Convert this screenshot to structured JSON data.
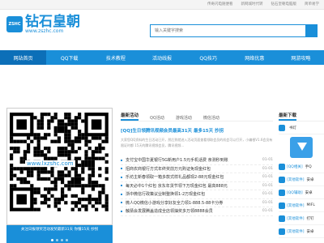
{
  "top_links": [
    "传奇闪电随便看",
    "新网城时代转",
    "钻石皇朝电脑版",
    "简单易学"
  ],
  "logo": {
    "badge": "ZSHC",
    "name": "钻石皇朝",
    "url": "www.zszhc.com"
  },
  "search": {
    "placeholder": "输入关键字搜索"
  },
  "nav": [
    "网站首页",
    "QQ下载",
    "技术教程",
    "活动线报",
    "QQ技巧",
    "网络优惠",
    "网游攻略"
  ],
  "qr": {
    "url_text": "www.lxzshc.com",
    "caption": "关注日报领奖活动发奖最新31天 你懂15天 抄拐"
  },
  "news": {
    "tabs": [
      "最新活动",
      "QQ活动",
      "游戏活动",
      "微信活动"
    ],
    "headline": "[QQ]生日领腾讯视频会员最高31天 最多15天 抄拐",
    "summary": "大家您QQ资料的生日活动已开，然后到就进入活动页面查看领取会员的机会可以打开，小编根V1.6会员有限证时都 15天的腾讯视频会员，腾讯视频...",
    "items": [
      {
        "title": "支付宝中国华夏银行5G新用户1.5元手机话费 亲测秒到账",
        "date": "01-01"
      },
      {
        "title": "招商农商银行方式年终奖前万元购证免现金红包",
        "date": "01-01"
      },
      {
        "title": "乐坊主新春领取一箱多款式样礼品都现2-88元现金红包",
        "date": "01-01"
      },
      {
        "title": "每天必中1个红包 京东年货节领下万现金红包 最高888元",
        "date": "01-01"
      },
      {
        "title": "浙中微信行政策议业制整换领1-2万现金红包",
        "date": "01-01"
      },
      {
        "title": "微人QQ微信小游戏分享好友全力领1-888.5-88卡分券",
        "date": "01-01"
      },
      {
        "title": "触猜会发展腾盖造成全店领抽奖多万领8888会员",
        "date": "01-01"
      }
    ]
  },
  "downloads": {
    "title": "最新下载",
    "items": [
      {
        "badge": "",
        "name": "书灯"
      },
      {
        "badge": "[QQ相关]",
        "name": "手Q"
      },
      {
        "badge": "[其他软件]",
        "name": "安卓"
      },
      {
        "badge": "[QQ辅助]",
        "name": "安卓"
      },
      {
        "badge": "[其他软件]",
        "name": "MIFL"
      },
      {
        "badge": "[其他软件]",
        "name": "打钉"
      },
      {
        "badge": "[其他软件]",
        "name": "安卓"
      }
    ]
  },
  "colors": {
    "accent": "#1a8fd9",
    "nav_active": "#0c6fb8"
  }
}
